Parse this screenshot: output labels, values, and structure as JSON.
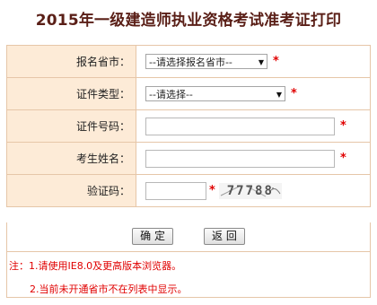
{
  "title": "2015年一级建造师执业资格考试准考证打印",
  "rows": [
    {
      "label": "报名省市：",
      "type": "select",
      "value": "--请选择报名省市--"
    },
    {
      "label": "证件类型：",
      "type": "select",
      "value": "--请选择--"
    },
    {
      "label": "证件号码：",
      "type": "input",
      "value": ""
    },
    {
      "label": "考生姓名：",
      "type": "input",
      "value": ""
    },
    {
      "label": "验证码：",
      "type": "input",
      "value": ""
    }
  ],
  "required_mark": "*",
  "captcha_text": "77788",
  "buttons": {
    "confirm": "确 定",
    "back": "返 回"
  },
  "notes": {
    "line1": "注：1.请使用IE8.0及更高版本浏览器。",
    "line2": "2.当前未开通省市不在列表中显示。"
  },
  "colors": {
    "title": "#5a1f17",
    "label_bg": "#fdebd7",
    "border": "#e6c6a8",
    "required": "#e00000"
  }
}
